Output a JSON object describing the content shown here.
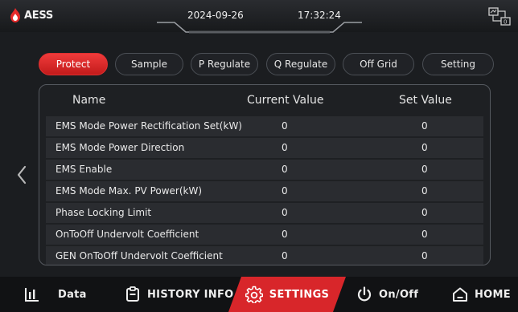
{
  "header": {
    "brand": "AESS",
    "date": "2024-09-26",
    "time": "17:32:24"
  },
  "tabs": [
    {
      "label": "Protect",
      "active": true
    },
    {
      "label": "Sample",
      "active": false
    },
    {
      "label": "P Regulate",
      "active": false
    },
    {
      "label": "Q Regulate",
      "active": false
    },
    {
      "label": "Off Grid",
      "active": false
    },
    {
      "label": "Setting",
      "active": false
    }
  ],
  "table": {
    "headers": [
      "Name",
      "Current Value",
      "Set Value"
    ],
    "rows": [
      {
        "name": "EMS Mode Power Rectification Set(kW)",
        "current": "0",
        "set": "0"
      },
      {
        "name": "EMS Mode Power Direction",
        "current": "0",
        "set": "0"
      },
      {
        "name": "EMS Enable",
        "current": "0",
        "set": "0"
      },
      {
        "name": "EMS Mode Max. PV Power(kW)",
        "current": "0",
        "set": "0"
      },
      {
        "name": "Phase Locking Limit",
        "current": "0",
        "set": "0"
      },
      {
        "name": "OnToOff Undervolt Coefficient",
        "current": "0",
        "set": "0"
      },
      {
        "name": "GEN OnToOff Undervolt Coefficient",
        "current": "0",
        "set": "0"
      }
    ]
  },
  "bottom_nav": [
    {
      "label": "Data",
      "icon": "bar-chart-icon",
      "active": false
    },
    {
      "label": "HISTORY INFO",
      "icon": "clipboard-icon",
      "active": false
    },
    {
      "label": "SETTINGS",
      "icon": "gear-icon",
      "active": true
    },
    {
      "label": "On/Off",
      "icon": "power-icon",
      "active": false
    },
    {
      "label": "HOME",
      "icon": "home-icon",
      "active": false
    }
  ],
  "colors": {
    "accent": "#d8262a",
    "background": "#1b1d20",
    "row": "#2a2c30"
  }
}
